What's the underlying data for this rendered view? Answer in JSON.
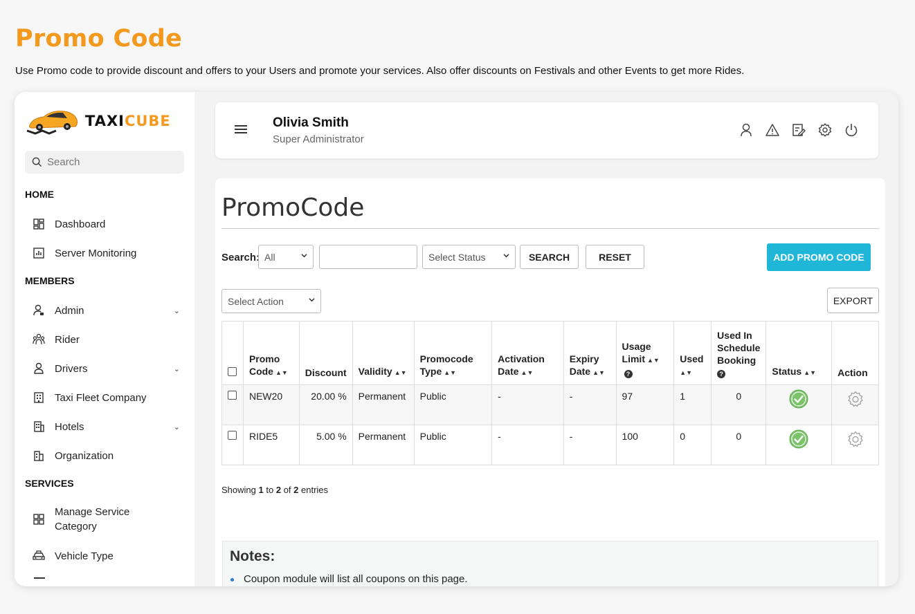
{
  "page": {
    "title": "Promo Code",
    "description": "Use Promo code to provide discount and offers to your Users and promote your services. Also offer discounts on Festivals and other Events to get more Rides."
  },
  "brand": {
    "part1": "TAXI",
    "part2": "CUBE",
    "accent": "#f39a1e"
  },
  "sidebar": {
    "search_placeholder": "Search",
    "sections": {
      "home": "HOME",
      "members": "MEMBERS",
      "services": "SERVICES"
    },
    "items": {
      "dashboard": "Dashboard",
      "server_monitoring": "Server Monitoring",
      "admin": "Admin",
      "rider": "Rider",
      "drivers": "Drivers",
      "taxi_fleet": "Taxi Fleet Company",
      "hotels": "Hotels",
      "organization": "Organization",
      "manage_service_line1": "Manage Service",
      "manage_service_line2": "Category",
      "vehicle_type": "Vehicle Type"
    }
  },
  "header": {
    "user_name": "Olivia Smith",
    "user_role": "Super Administrator"
  },
  "content": {
    "title": "PromoCode",
    "search_label": "Search:",
    "filter_select": "All",
    "status_select": "Select Status",
    "search_button": "SEARCH",
    "reset_button": "RESET",
    "add_button": "ADD PROMO CODE",
    "action_select": "Select Action",
    "export_button": "EXPORT",
    "columns": {
      "promo_code_1": "Promo",
      "promo_code_2": "Code",
      "discount": "Discount",
      "validity": "Validity",
      "type_1": "Promocode",
      "type_2": "Type",
      "activation_1": "Activation",
      "activation_2": "Date",
      "expiry_1": "Expiry",
      "expiry_2": "Date",
      "usage_1": "Usage",
      "usage_2": "Limit",
      "used": "Used",
      "sched_1": "Used In",
      "sched_2": "Schedule",
      "sched_3": "Booking",
      "status": "Status",
      "action": "Action"
    },
    "rows": [
      {
        "code": "NEW20",
        "discount": "20.00 %",
        "validity": "Permanent",
        "type": "Public",
        "activation": "-",
        "expiry": "-",
        "usage_limit": "97",
        "used": "1",
        "used_schedule": "0"
      },
      {
        "code": "RIDE5",
        "discount": "5.00 %",
        "validity": "Permanent",
        "type": "Public",
        "activation": "-",
        "expiry": "-",
        "usage_limit": "100",
        "used": "0",
        "used_schedule": "0"
      }
    ],
    "showing": {
      "prefix": "Showing",
      "from": "1",
      "to_word": "to",
      "to": "2",
      "of_word": "of",
      "total": "2",
      "suffix": "entries"
    },
    "notes_title": "Notes:",
    "notes_item": "Coupon module will list all coupons on this page."
  },
  "colors": {
    "primary_button": "#1fb6d8",
    "status_ok": "#7cc46a"
  }
}
